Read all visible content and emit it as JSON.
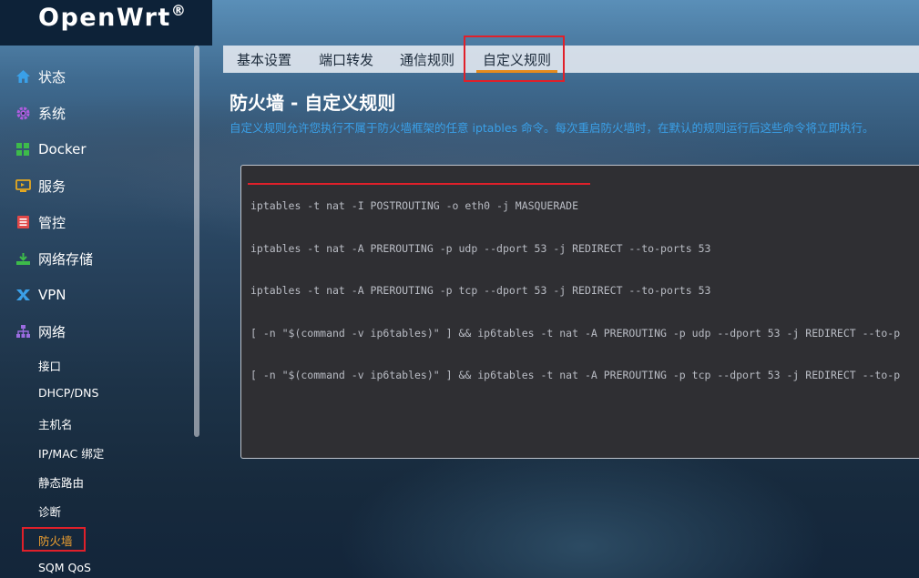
{
  "brand": {
    "name": "OpenWrt",
    "reg": "®"
  },
  "tabs": [
    {
      "label": "基本设置",
      "active": false
    },
    {
      "label": "端口转发",
      "active": false
    },
    {
      "label": "通信规则",
      "active": false
    },
    {
      "label": "自定义规则",
      "active": true
    }
  ],
  "sidebar": {
    "items": [
      {
        "label": "状态",
        "icon": "home-icon",
        "color": "#3aa0e8"
      },
      {
        "label": "系统",
        "icon": "gear-icon",
        "color": "#b05ce0"
      },
      {
        "label": "Docker",
        "icon": "docker-icon",
        "color": "#3dbb4a"
      },
      {
        "label": "服务",
        "icon": "services-icon",
        "color": "#e5a820"
      },
      {
        "label": "管控",
        "icon": "control-icon",
        "color": "#e04848"
      },
      {
        "label": "网络存储",
        "icon": "storage-icon",
        "color": "#3dbb4a"
      },
      {
        "label": "VPN",
        "icon": "vpn-icon",
        "color": "#3aa0e8"
      },
      {
        "label": "网络",
        "icon": "network-icon",
        "color": "#9b6ce0"
      }
    ],
    "sub_items": [
      {
        "label": "接口",
        "active": false
      },
      {
        "label": "DHCP/DNS",
        "active": false
      },
      {
        "label": "主机名",
        "active": false
      },
      {
        "label": "IP/MAC 绑定",
        "active": false
      },
      {
        "label": "静态路由",
        "active": false
      },
      {
        "label": "诊断",
        "active": false
      },
      {
        "label": "防火墙",
        "active": true
      },
      {
        "label": "SQM QoS",
        "active": false
      }
    ]
  },
  "main": {
    "title": "防火墙 - 自定义规则",
    "description": "自定义规则允许您执行不属于防火墙框架的任意 iptables 命令。每次重启防火墙时，在默认的规则运行后这些命令将立即执行。",
    "code_lines": [
      "iptables -t nat -I POSTROUTING -o eth0 -j MASQUERADE",
      "iptables -t nat -A PREROUTING -p udp --dport 53 -j REDIRECT --to-ports 53",
      "iptables -t nat -A PREROUTING -p tcp --dport 53 -j REDIRECT --to-ports 53",
      "[ -n \"$(command -v ip6tables)\" ] && ip6tables -t nat -A PREROUTING -p udp --dport 53 -j REDIRECT --to-p",
      "[ -n \"$(command -v ip6tables)\" ] && ip6tables -t nat -A PREROUTING -p tcp --dport 53 -j REDIRECT --to-p"
    ]
  },
  "colors": {
    "accent": "#e58b1c",
    "highlight_box": "#e0202a",
    "link_blue": "#3aa0e8"
  }
}
